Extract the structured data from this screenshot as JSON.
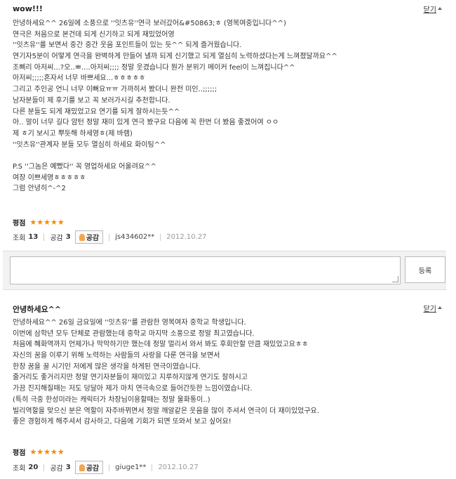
{
  "reviews": [
    {
      "title": "wow!!!",
      "close_label": "닫기",
      "lines": [
        "안녕하세요^^ 26일에 소풍으로 ''잇츠유''연극 보러갔어&#50863;ㅎ (영복여중입니다^^)",
        "연극은 처음으로 본건데 되게 신기하고 되게 재밌었어영",
        "''잇츠유''를 보면서 중간 중간 웃음 포인트들이 있는 듯^^ 되게 즐거웠습니다.",
        "연기자5분이 어떻게 연극을 완벽하게 만들어 낼까 되게 신기했고 되게 열심히 노력하셨다는게 느껴졌달까요^^",
        "조삐리 아저씨...?오..ㅃ....아저씨;;;; 정말 웃겼습니다 뭔가 분위기 메이커 feel이 느껴집니다^^",
        "아저씨;;;;;혼자서 너무 바쁘세요...ㅎㅎㅎㅎㅎ",
        "그리고 주인공 언니 너무 이뻐요ㅠㅠ 가까히서 봤더니 완전 미인..;;;;;;",
        "남자분들이 제 후기를 보고 꼭 보러가시길 추천합니다.",
        "다른 분들도 되게 재밌었고요 연기를 되게 잘하시는듯^^",
        "아.. 말이 너무 길다 암턴 정말 재미 있게 연극 봤구요 다음에 꼭 한번 더 봤음 좋겠어여 ㅇㅇ",
        "제 ㅎ기 보시고 뿌듯해 하세영ㅎ(제 바램)",
        "''잇츠유''관계자 분들 모두 열심히 하세요 화이팅^^",
        "",
        "P.S ''그놈은 예뻤다'' 꼭 영업하세요 어울려요^^",
        "여장 이쁘세영ㅎㅎㅎㅎㅎ",
        "그럼 안녕히^-^2"
      ],
      "rating_label": "평점",
      "stars": 5,
      "views_label": "조회",
      "views": "13",
      "empathy_label": "공감",
      "empathy": "3",
      "like_button": "공감",
      "user": "js434602**",
      "date": "2012.10.27"
    },
    {
      "title": "안녕하세요^^",
      "close_label": "닫기",
      "lines": [
        "안녕하세요^^ 26일 금요일에 ''잇츠유''를 관람한 영복여자 중학교 학생입니다.",
        "이번에 삼학년 모두 단체로 관람했는데 중학교 마지막 소풍으로 정말 최고였습니다.",
        "처음에 혜화역까지 언제가나 막막하기만 했는데 정말 멀리서 와서 봐도 후회안할 만큼 재밌었고요ㅎㅎ",
        "자신의 꿈을 이루기 위해 노력하는 사람들의 사랑을 다룬 연극을 보면서",
        "한창 꿈을 꿀 시기인 저에게 많은 생각을 하게된 연극이였습니다.",
        "줄거리도 좋거리지만 정말 연기자분들이 재미있고 지루하지않게 연기도 잘하시고",
        "가끔 진지해질때는 저도 덩달아 제가 마치 연극속으로 들어간듯한 느낌이였습니다.",
        "(특히 극중 한성미라는 캐릭터가 차장님이용할때는 정말 울화통이..)",
        "빌리역할을 맞으신 분은 역할이 자주바뀌면서 정말 깨알같은 웃음을 많이 주셔서 연극이 더 재미있었구요.",
        "좋은 경험하게 해주셔서 감사하고, 다음에 기회가 되면 또와서 보고 싶어요!"
      ],
      "rating_label": "평점",
      "stars": 5,
      "views_label": "조회",
      "views": "20",
      "empathy_label": "공감",
      "empathy": "3",
      "like_button": "공감",
      "user": "giuge1**",
      "date": "2012.10.27"
    }
  ],
  "comment": {
    "placeholder": "",
    "submit_label": "등록"
  }
}
